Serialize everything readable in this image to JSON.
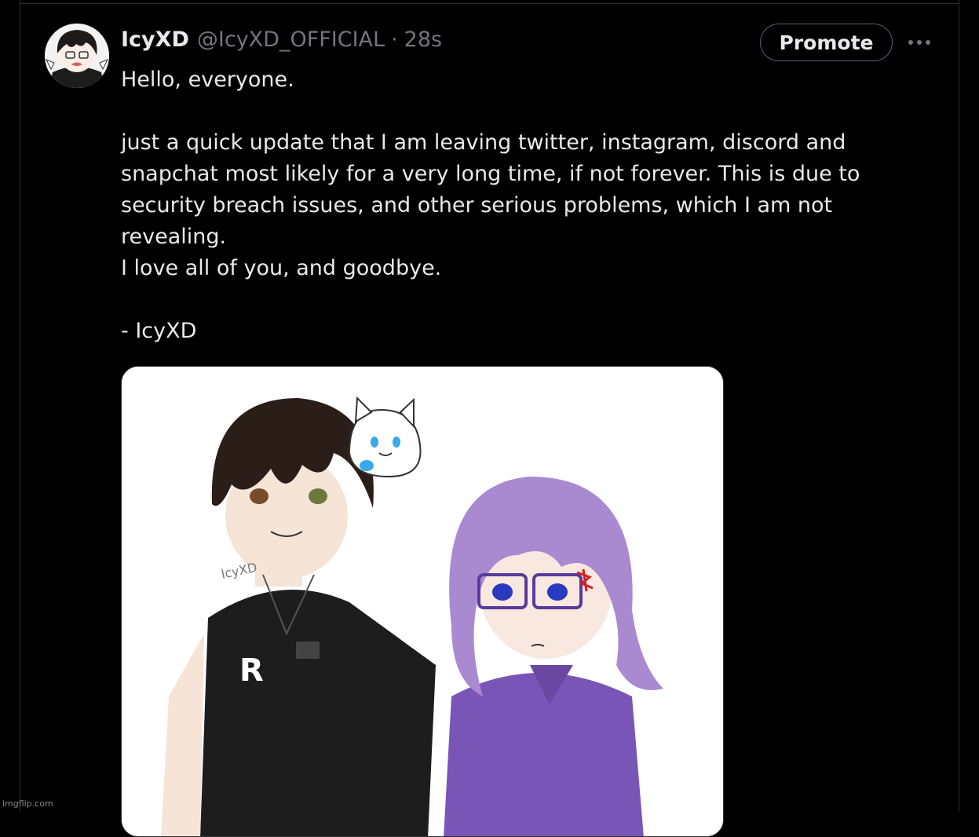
{
  "tweet": {
    "display_name": "IcyXD",
    "handle": "@IcyXD_OFFICIAL",
    "separator": "·",
    "timestamp": "28s",
    "promote_label": "Promote",
    "paragraphs": [
      "Hello, everyone.",
      "",
      "just a quick update that I am leaving twitter, instagram, discord and snapchat most likely for a very long time, if not forever. This is due to security breach issues, and other serious problems, which I am not revealing.",
      "I love all of you, and goodbye.",
      "",
      "- IcyXD"
    ],
    "media": {
      "artist_signature": "IcyXD",
      "shirt_logo": "R",
      "colors": {
        "left_hair": "#2b1d18",
        "left_shirt": "#1a1a1a",
        "right_hair": "#a98ad1",
        "right_jacket": "#7a55b8",
        "mascot": "#ffffff"
      }
    }
  },
  "watermark": "imgflip.com",
  "colors": {
    "background": "#000000",
    "text_primary": "#e7e9ea",
    "text_secondary": "#71767b",
    "border": "#2f3336"
  }
}
